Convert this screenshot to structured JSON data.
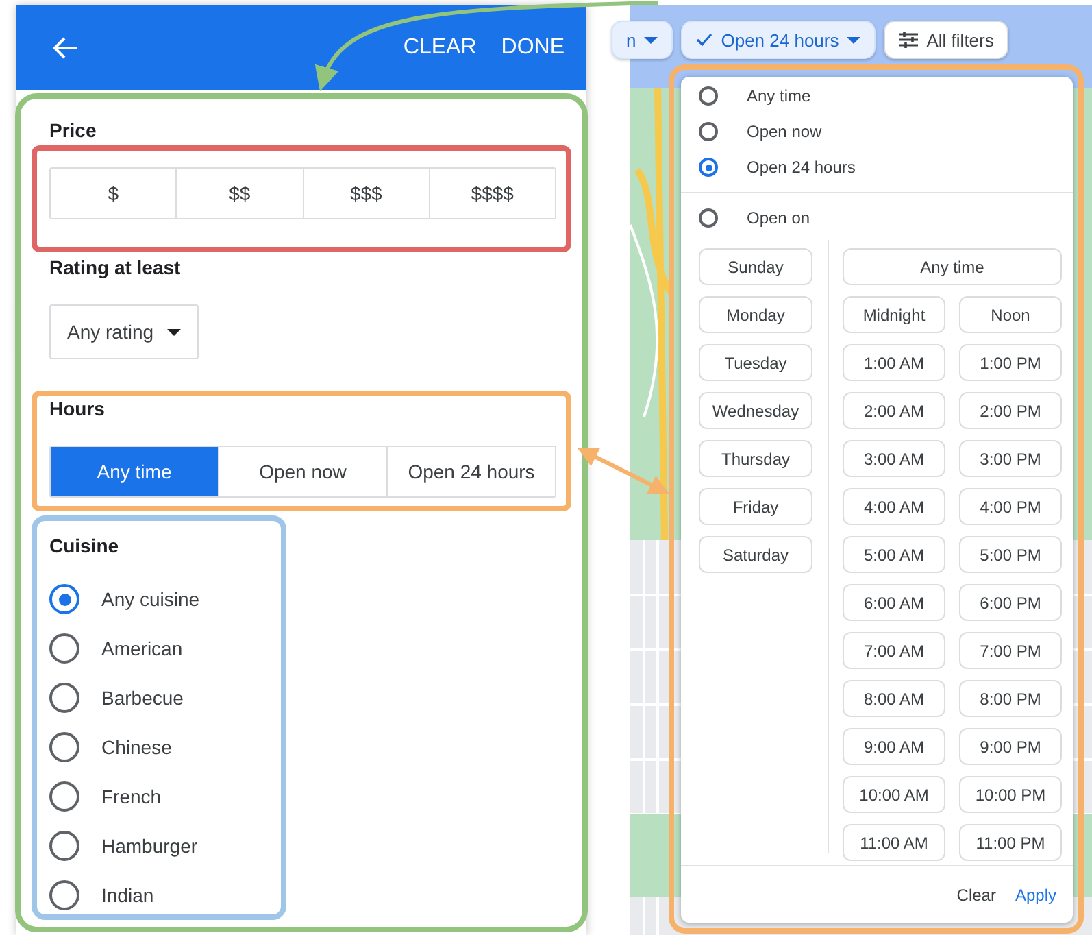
{
  "left_panel": {
    "header": {
      "actions": [
        "CLEAR",
        "DONE"
      ]
    },
    "price": {
      "title": "Price",
      "options": [
        {
          "label": "$",
          "selected": false
        },
        {
          "label": "$$",
          "selected": false
        },
        {
          "label": "$$$",
          "selected": false
        },
        {
          "label": "$$$$",
          "selected": false
        }
      ]
    },
    "rating": {
      "title": "Rating at least",
      "value": "Any rating"
    },
    "hours": {
      "title": "Hours",
      "options": [
        {
          "label": "Any time",
          "selected": true
        },
        {
          "label": "Open now",
          "selected": false
        },
        {
          "label": "Open 24 hours",
          "selected": false
        }
      ]
    },
    "cuisine": {
      "title": "Cuisine",
      "options": [
        {
          "label": "Any cuisine",
          "selected": true
        },
        {
          "label": "American",
          "selected": false
        },
        {
          "label": "Barbecue",
          "selected": false
        },
        {
          "label": "Chinese",
          "selected": false
        },
        {
          "label": "French",
          "selected": false
        },
        {
          "label": "Hamburger",
          "selected": false
        },
        {
          "label": "Indian",
          "selected": false
        }
      ]
    }
  },
  "right_panel": {
    "chips": [
      {
        "label": "n",
        "kind": "dropdown",
        "selected": true,
        "checked": false
      },
      {
        "label": "Open 24 hours",
        "kind": "dropdown",
        "selected": true,
        "checked": true
      },
      {
        "label": "All filters",
        "kind": "filters",
        "selected": false,
        "checked": false
      }
    ],
    "hours_menu": {
      "options": [
        {
          "label": "Any time",
          "selected": false
        },
        {
          "label": "Open now",
          "selected": false
        },
        {
          "label": "Open 24 hours",
          "selected": true
        }
      ],
      "open_on": {
        "label": "Open on",
        "selected": false
      },
      "days": [
        "Sunday",
        "Monday",
        "Tuesday",
        "Wednesday",
        "Thursday",
        "Friday",
        "Saturday"
      ],
      "any_time": "Any time",
      "times": [
        "Midnight",
        "Noon",
        "1:00 AM",
        "1:00 PM",
        "2:00 AM",
        "2:00 PM",
        "3:00 AM",
        "3:00 PM",
        "4:00 AM",
        "4:00 PM",
        "5:00 AM",
        "5:00 PM",
        "6:00 AM",
        "6:00 PM",
        "7:00 AM",
        "7:00 PM",
        "8:00 AM",
        "8:00 PM",
        "9:00 AM",
        "9:00 PM",
        "10:00 AM",
        "10:00 PM",
        "11:00 AM",
        "11:00 PM"
      ],
      "footer": {
        "clear": "Clear",
        "apply": "Apply"
      }
    }
  }
}
